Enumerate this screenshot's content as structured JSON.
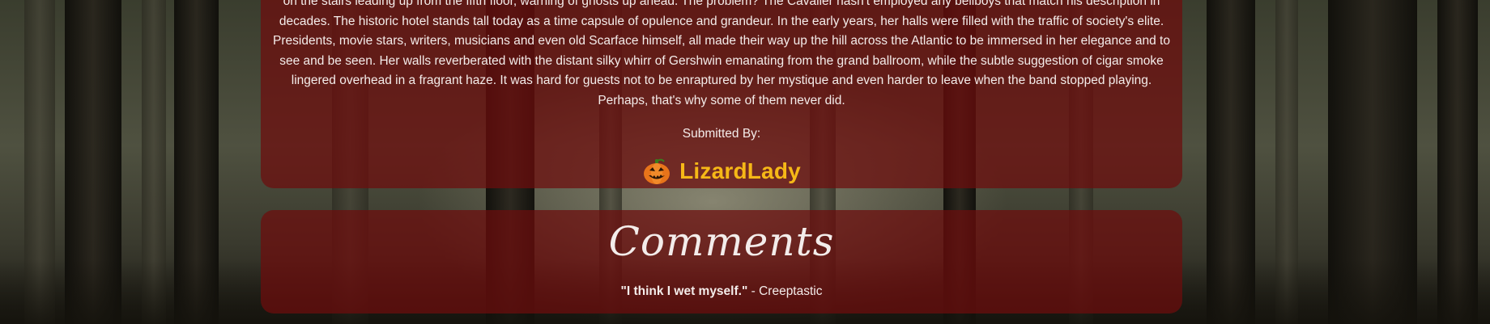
{
  "story": {
    "paragraph": "on the stairs leading up from the fifth floor, warning of ghosts up ahead. The problem? The Cavalier hasn't employed any bellboys that match his description in decades. The historic hotel stands tall today as a time capsule of opulence and grandeur. In the early years, her halls were filled with the traffic of society's elite. Presidents, movie stars, writers, musicians and even old Scarface himself, all made their way up the hill across the Atlantic to be immersed in her elegance and to see and be seen. Her walls reverberated with the distant silky whirr of Gershwin emanating from the grand ballroom, while the subtle suggestion of cigar smoke lingered overhead in a fragrant haze. It was hard for guests not to be enraptured by her mystique and even harder to leave when the band stopped playing. Perhaps, that's why some of them never did.",
    "submitted_by_label": "Submitted By:",
    "author": {
      "name": "LizardLady",
      "icon": "jack-o-lantern-icon",
      "name_color": "#f6b817"
    }
  },
  "comments": {
    "title": "Comments",
    "items": [
      {
        "quote": "\"I think I wet myself.\"",
        "separator": " - ",
        "author": "Creeptastic"
      }
    ]
  },
  "colors": {
    "panel": "#6e0c0c",
    "accent": "#f6b817",
    "text": "#f4ecea"
  }
}
